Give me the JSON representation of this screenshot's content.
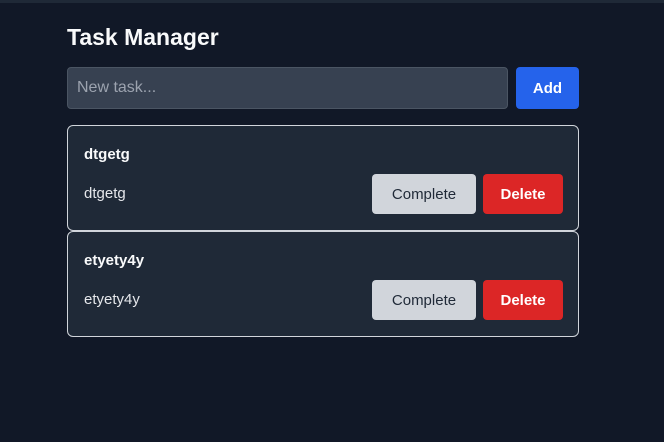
{
  "app": {
    "title": "Task Manager"
  },
  "new_task": {
    "placeholder": "New task...",
    "value": "",
    "add_label": "Add"
  },
  "tasks": [
    {
      "title": "dtgetg",
      "description": "dtgetg",
      "complete_label": "Complete",
      "delete_label": "Delete"
    },
    {
      "title": "etyety4y",
      "description": "etyety4y",
      "complete_label": "Complete",
      "delete_label": "Delete"
    }
  ],
  "colors": {
    "background": "#111827",
    "card": "#1f2937",
    "input": "#374151",
    "add_button": "#2563eb",
    "complete_button": "#d1d5db",
    "delete_button": "#dc2626"
  }
}
